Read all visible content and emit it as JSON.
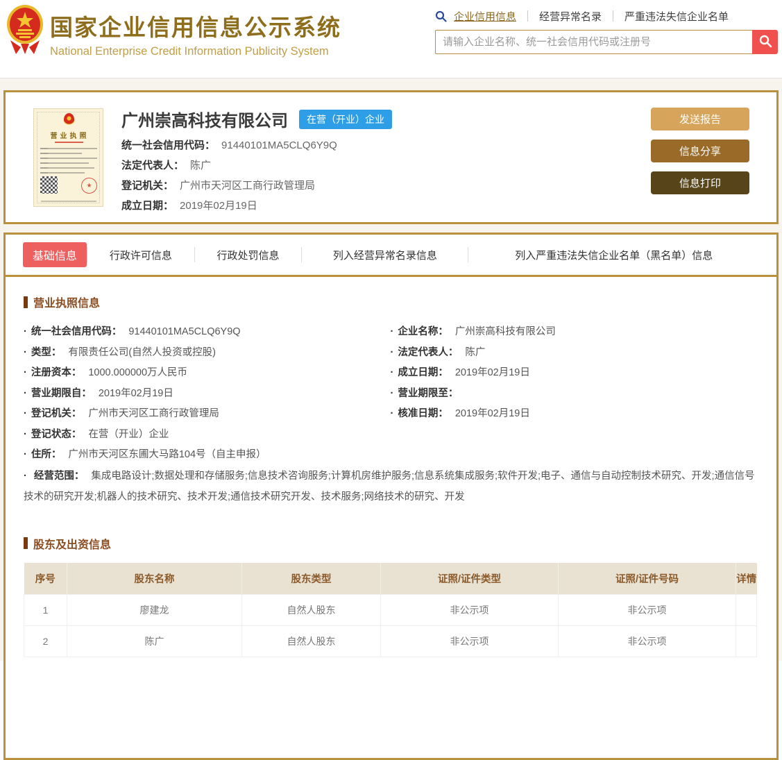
{
  "header": {
    "title_cn": "国家企业信用信息公示系统",
    "title_en": "National Enterprise Credit Information Publicity System",
    "nav": [
      {
        "label": "企业信用信息",
        "active": true
      },
      {
        "label": "经营异常名录",
        "active": false
      },
      {
        "label": "严重违法失信企业名单",
        "active": false
      }
    ],
    "search_placeholder": "请输入企业名称、统一社会信用代码或注册号"
  },
  "company_card": {
    "license_title": "营业执照",
    "name": "广州崇高科技有限公司",
    "status_badge": "在营（开业）企业",
    "fields": [
      {
        "label": "统一社会信用代码：",
        "value": "91440101MA5CLQ6Y9Q"
      },
      {
        "label": "法定代表人：",
        "value": "陈广"
      },
      {
        "label": "登记机关：",
        "value": "广州市天河区工商行政管理局"
      },
      {
        "label": "成立日期：",
        "value": "2019年02月19日"
      }
    ],
    "buttons": [
      {
        "label": "发送报告"
      },
      {
        "label": "信息分享"
      },
      {
        "label": "信息打印"
      }
    ]
  },
  "tabs": [
    {
      "label": "基础信息",
      "active": true
    },
    {
      "label": "行政许可信息",
      "active": false
    },
    {
      "label": "行政处罚信息",
      "active": false
    },
    {
      "label": "列入经营异常名录信息",
      "active": false
    },
    {
      "label": "列入严重违法失信企业名单（黑名单）信息",
      "active": false
    }
  ],
  "license_info": {
    "section_title": "营业执照信息",
    "left": [
      {
        "label": "统一社会信用代码：",
        "value": "91440101MA5CLQ6Y9Q"
      },
      {
        "label": "类型：",
        "value": "有限责任公司(自然人投资或控股)"
      },
      {
        "label": "注册资本：",
        "value": "1000.000000万人民币"
      },
      {
        "label": "营业期限自：",
        "value": "2019年02月19日"
      },
      {
        "label": "登记机关：",
        "value": "广州市天河区工商行政管理局"
      },
      {
        "label": "登记状态：",
        "value": "在营（开业）企业"
      },
      {
        "label": "住所：",
        "value": "广州市天河区东圃大马路104号（自主申报）"
      }
    ],
    "right": [
      {
        "label": "企业名称：",
        "value": "广州崇高科技有限公司"
      },
      {
        "label": "法定代表人：",
        "value": "陈广"
      },
      {
        "label": "成立日期：",
        "value": "2019年02月19日"
      },
      {
        "label": "营业期限至：",
        "value": ""
      },
      {
        "label": "核准日期：",
        "value": "2019年02月19日"
      }
    ],
    "scope": {
      "label": "经营范围：",
      "value": "集成电路设计;数据处理和存储服务;信息技术咨询服务;计算机房维护服务;信息系统集成服务;软件开发;电子、通信与自动控制技术研究、开发;通信信号技术的研究开发;机器人的技术研究、技术开发;通信技术研究开发、技术服务;网络技术的研究、开发"
    }
  },
  "shareholders": {
    "section_title": "股东及出资信息",
    "columns": [
      "序号",
      "股东名称",
      "股东类型",
      "证照/证件类型",
      "证照/证件号码",
      "详情"
    ],
    "rows": [
      [
        "1",
        "廖建龙",
        "自然人股东",
        "非公示项",
        "非公示项",
        ""
      ],
      [
        "2",
        "陈广",
        "自然人股东",
        "非公示项",
        "非公示项",
        ""
      ]
    ]
  },
  "colors": {
    "gold_border": "#b9913d",
    "brand_gold": "#8e6d1c",
    "brand_gold_light": "#bf9e45",
    "tab_active_red": "#ee5f5f",
    "search_button_red": "#f0504e",
    "status_badge_blue": "#2e9fe6",
    "section_title_brown": "#8a4d21",
    "table_header_bg": "#e9e1d2",
    "table_header_text": "#8a5a2b",
    "button_send_report": "#d6a45a",
    "button_share": "#9a6b28",
    "button_print": "#584419"
  }
}
